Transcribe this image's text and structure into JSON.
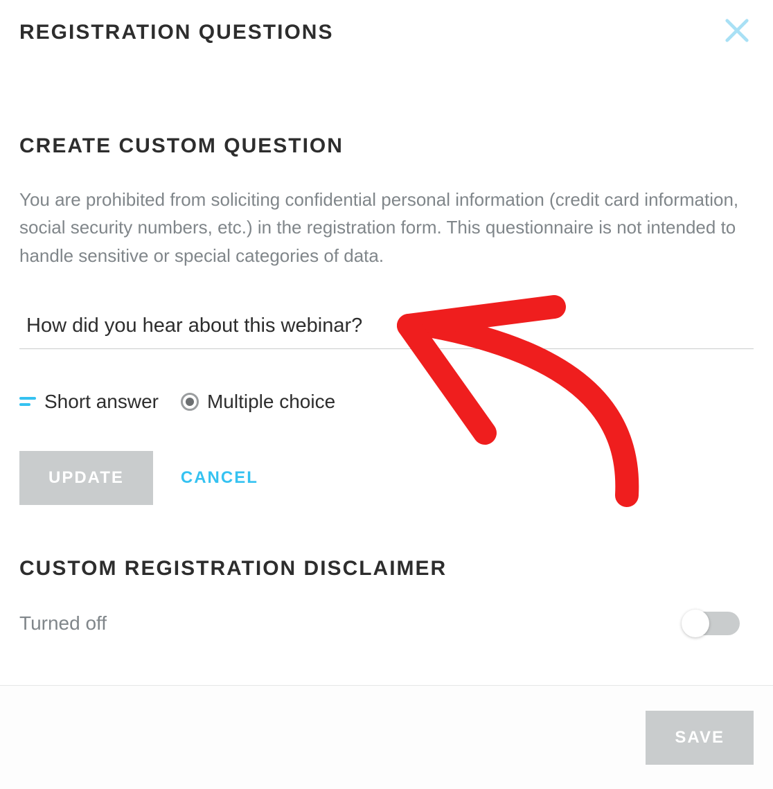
{
  "modal": {
    "title": "REGISTRATION QUESTIONS"
  },
  "create": {
    "heading": "CREATE CUSTOM QUESTION",
    "description": "You are prohibited from soliciting confidential personal information (credit card information, social security numbers, etc.) in the registration form. This questionnaire is not intended to handle sensitive or special categories of data.",
    "question_value": "How did you hear about this webinar?",
    "types": {
      "short_label": "Short answer",
      "multiple_label": "Multiple choice"
    },
    "buttons": {
      "update": "UPDATE",
      "cancel": "CANCEL"
    }
  },
  "disclaimer": {
    "heading": "CUSTOM REGISTRATION DISCLAIMER",
    "status": "Turned off"
  },
  "footer": {
    "save": "SAVE"
  }
}
